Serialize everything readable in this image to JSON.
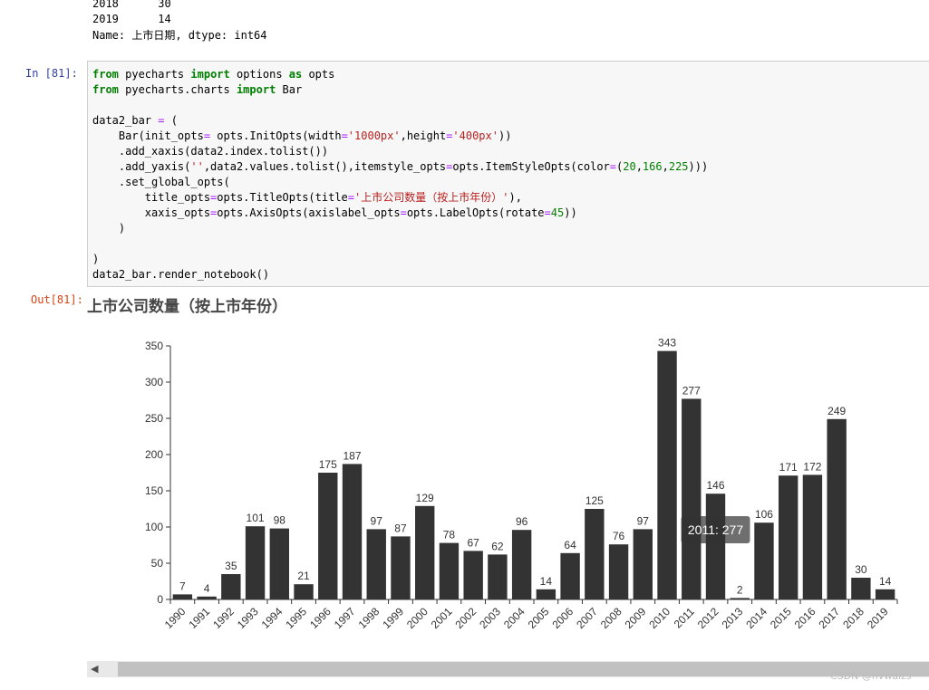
{
  "prev_output": {
    "line1": "2018      30",
    "line2": "2019      14",
    "line3": "Name: 上市日期, dtype: int64"
  },
  "cell": {
    "in_prompt": "In  [81]:",
    "out_prompt": "Out[81]:"
  },
  "chart_data": {
    "type": "bar",
    "title": "上市公司数量（按上市年份）",
    "categories": [
      "1990",
      "1991",
      "1992",
      "1993",
      "1994",
      "1995",
      "1996",
      "1997",
      "1998",
      "1999",
      "2000",
      "2001",
      "2002",
      "2003",
      "2004",
      "2005",
      "2006",
      "2007",
      "2008",
      "2009",
      "2010",
      "2011",
      "2012",
      "2013",
      "2014",
      "2015",
      "2016",
      "2017",
      "2018",
      "2019"
    ],
    "values": [
      7,
      4,
      35,
      101,
      98,
      21,
      175,
      187,
      97,
      87,
      129,
      78,
      67,
      62,
      96,
      14,
      64,
      125,
      76,
      97,
      343,
      277,
      146,
      2,
      106,
      171,
      172,
      249,
      30,
      14
    ],
    "ylim": [
      0,
      350
    ],
    "yticks": [
      "0",
      "50",
      "100",
      "150",
      "200",
      "250",
      "300",
      "350"
    ],
    "bar_color": "#333333",
    "xlabel_rotate": 45,
    "tooltip": "2011: 277"
  },
  "watermark": "CSDN @hvwalzs",
  "scroll_left_glyph": "◀"
}
